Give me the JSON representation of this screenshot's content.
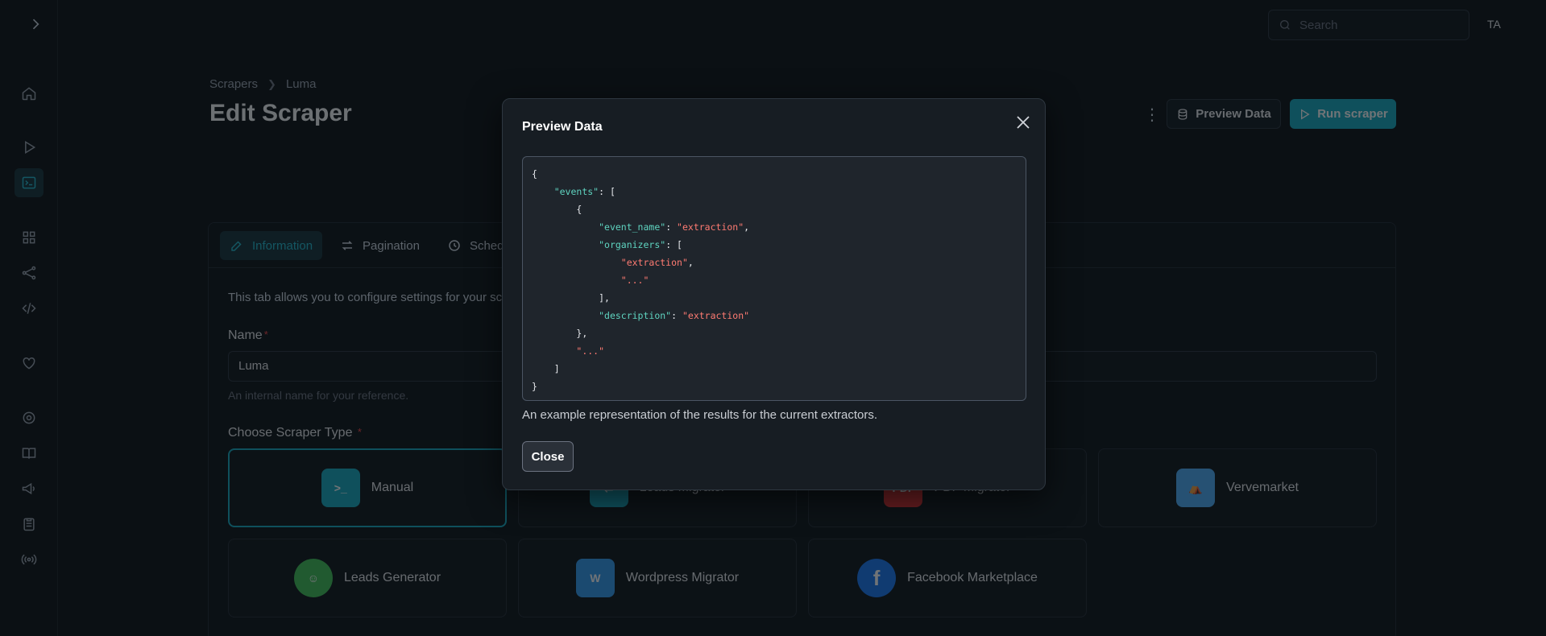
{
  "topbar": {
    "search_placeholder": "Search",
    "avatar_initials": "TA"
  },
  "breadcrumb": {
    "root": "Scrapers",
    "current": "Luma"
  },
  "page": {
    "title": "Edit Scraper"
  },
  "actions": {
    "preview_label": "Preview Data",
    "run_label": "Run scraper"
  },
  "tabs": [
    {
      "label": "Information",
      "active": true
    },
    {
      "label": "Pagination"
    },
    {
      "label": "Schedul"
    }
  ],
  "form": {
    "description": "This tab allows you to configure settings for your sc",
    "name_label": "Name",
    "required_mark": "*",
    "name_value": "Luma",
    "name_hint": "An internal name for your reference.",
    "type_label": "Choose Scraper Type"
  },
  "scraper_types": [
    {
      "label": "Manual",
      "selected": true,
      "icon": "terminal-icon",
      "color": "#15aabf"
    },
    {
      "label": "Leads Migrator",
      "icon": "migrate-icon",
      "color": "#15aabf"
    },
    {
      "label": "PDF Migrator",
      "icon": "pdf-icon",
      "color": "#e03131"
    },
    {
      "label": "Vervemarket",
      "icon": "store-icon",
      "color": "#4dabf7"
    },
    {
      "label": "Leads Generator",
      "icon": "emoji-faces-icon",
      "color": "#40c057"
    },
    {
      "label": "Wordpress Migrator",
      "icon": "wordpress-icon",
      "color": "#339af0"
    },
    {
      "label": "Facebook Marketplace",
      "icon": "facebook-icon",
      "color": "#1877f2"
    }
  ],
  "modal": {
    "title": "Preview Data",
    "description": "An example representation of the results for the current extractors.",
    "close_label": "Close",
    "code": {
      "open_brace": "{",
      "events_key": "\"events\"",
      "event_name_key": "\"event_name\"",
      "organizers_key": "\"organizers\"",
      "description_key": "\"description\"",
      "value": "\"extraction\"",
      "ellipsis": "\"...\"",
      "close_brace": "}"
    }
  },
  "colors": {
    "accent": "#15aabf",
    "key": "#5fd4c0",
    "string": "#ff7b72"
  }
}
